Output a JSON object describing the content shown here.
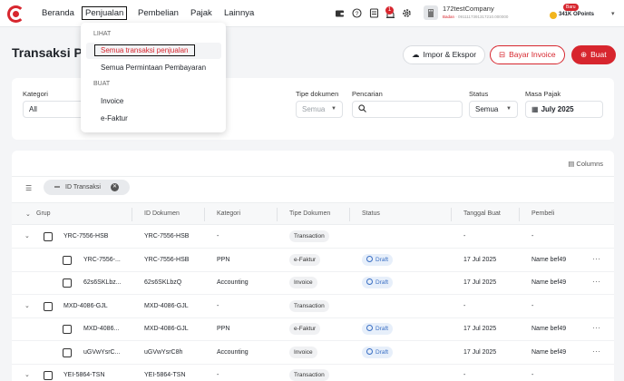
{
  "nav": {
    "items": [
      "Beranda",
      "Penjualan",
      "Pembelian",
      "Pajak",
      "Lainnya"
    ],
    "notification_count": "1",
    "company": {
      "name": "172testCompany",
      "badge_label": "Badan",
      "npwp": "0911117391317210.000000"
    },
    "points": {
      "new_badge": "Baru",
      "value": "341K OPoints"
    }
  },
  "page": {
    "title": "Transaksi Pe",
    "buttons": {
      "import_export": "Impor & Ekspor",
      "pay_invoice": "Bayar Invoice",
      "create": "Buat"
    }
  },
  "filters": {
    "category_label": "Kategori",
    "category_value": "All",
    "doc_type_label": "Tipe dokumen",
    "doc_type_value": "Semua",
    "search_label": "Pencarian",
    "search_placeholder": "",
    "status_label": "Status",
    "status_value": "Semua",
    "tax_period_label": "Masa Pajak",
    "tax_period_value": "July 2025"
  },
  "table": {
    "columns_label": "Columns",
    "chip_label": "ID Transaksi",
    "headers": [
      "Grup",
      "ID Dokumen",
      "Kategori",
      "Tipe Dokumen",
      "Status",
      "Tanggal Buat",
      "Pembeli"
    ],
    "rows": [
      {
        "kind": "group",
        "grup": "YRC-7556-HSB",
        "id": "YRC-7556-HSB",
        "kategori": "-",
        "tipe": "Transaction",
        "status": "",
        "tanggal": "-",
        "pembeli": "-"
      },
      {
        "kind": "child",
        "grup": "YRC-7556-...",
        "id": "YRC-7556-HSB",
        "kategori": "PPN",
        "tipe": "e-Faktur",
        "status": "Draft",
        "tanggal": "17 Jul 2025",
        "pembeli": "Name bef49"
      },
      {
        "kind": "child",
        "grup": "62s6SKLbz...",
        "id": "62s6SKLbzQ",
        "kategori": "Accounting",
        "tipe": "Invoice",
        "status": "Draft",
        "tanggal": "17 Jul 2025",
        "pembeli": "Name bef49"
      },
      {
        "kind": "group",
        "grup": "MXD-4086-GJL",
        "id": "MXD-4086-GJL",
        "kategori": "-",
        "tipe": "Transaction",
        "status": "",
        "tanggal": "-",
        "pembeli": "-"
      },
      {
        "kind": "child",
        "grup": "MXD-4086...",
        "id": "MXD-4086-GJL",
        "kategori": "PPN",
        "tipe": "e-Faktur",
        "status": "Draft",
        "tanggal": "17 Jul 2025",
        "pembeli": "Name bef49"
      },
      {
        "kind": "child",
        "grup": "uGVwYsrC...",
        "id": "uGVwYsrC8h",
        "kategori": "Accounting",
        "tipe": "Invoice",
        "status": "Draft",
        "tanggal": "17 Jul 2025",
        "pembeli": "Name bef49"
      },
      {
        "kind": "group",
        "grup": "YEI-5864-TSN",
        "id": "YEI-5864-TSN",
        "kategori": "-",
        "tipe": "Transaction",
        "status": "",
        "tanggal": "-",
        "pembeli": "-"
      }
    ]
  },
  "dropdown": {
    "view_section": "LIHAT",
    "view_items": [
      "Semua transaksi penjualan",
      "Semua Permintaan Pembayaran"
    ],
    "create_section": "BUAT",
    "create_items": [
      "Invoice",
      "e-Faktur"
    ]
  },
  "colors": {
    "brand": "#d7262e",
    "draft": "#3a6fc4"
  }
}
